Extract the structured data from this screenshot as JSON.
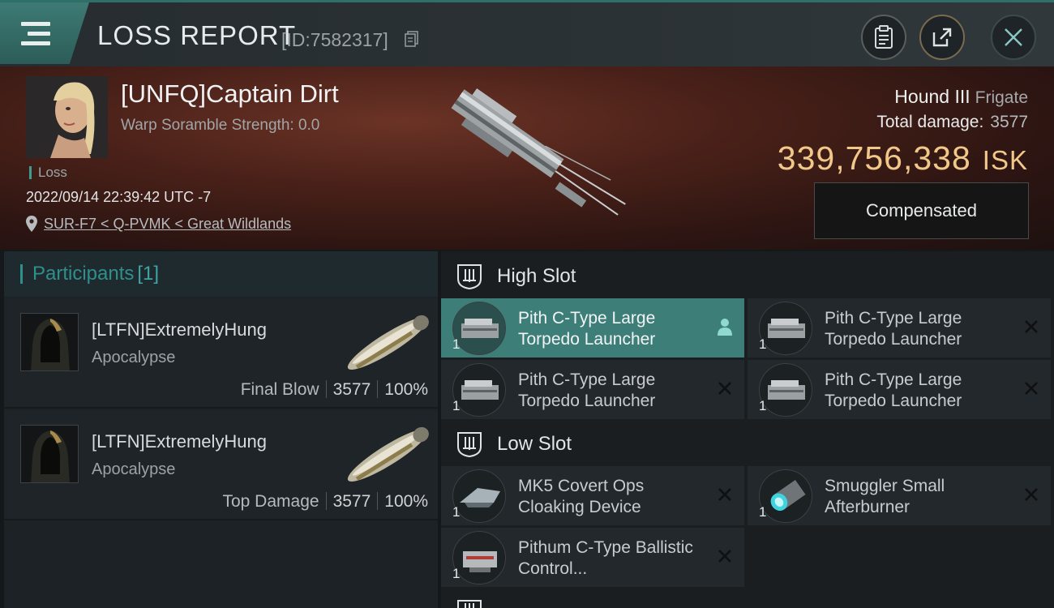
{
  "topbar": {
    "title": "LOSS REPORT",
    "report_id": "[ID:7582317]",
    "buttons": [
      "clipboard-icon",
      "share-icon",
      "close-icon"
    ]
  },
  "victim": {
    "name": "[UNFQ]Captain Dirt",
    "warp_scramble": "Warp Soramble Strength: 0.0",
    "status": "Loss",
    "datetime": "2022/09/14 22:39:42 UTC -7",
    "location": "SUR-F7 < Q-PVMK < Great Wildlands",
    "ship_name": "Hound III",
    "ship_type": "Frigate",
    "total_damage_label": "Total damage:",
    "total_damage": "3577",
    "isk_value": "339,756,338",
    "isk_unit": "ISK",
    "compensated_label": "Compensated"
  },
  "participants": {
    "title": "Participants",
    "count": "[1]",
    "rows": [
      {
        "name": "[LTFN]ExtremelyHung",
        "ship": "Apocalypse",
        "role": "Final Blow",
        "damage": "3577",
        "percent": "100%"
      },
      {
        "name": "[LTFN]ExtremelyHung",
        "ship": "Apocalypse",
        "role": "Top Damage",
        "damage": "3577",
        "percent": "100%"
      }
    ]
  },
  "fitting": {
    "high_slot_label": "High Slot",
    "low_slot_label": "Low Slot",
    "high": [
      {
        "name": "Pith C-Type Large Torpedo Launcher",
        "qty": "1"
      },
      {
        "name": "Pith C-Type Large Torpedo Launcher",
        "qty": "1"
      },
      {
        "name": "Pith C-Type Large Torpedo Launcher",
        "qty": "1"
      },
      {
        "name": "Pith C-Type Large Torpedo Launcher",
        "qty": "1"
      }
    ],
    "low": [
      {
        "name": "MK5 Covert Ops Cloaking Device",
        "qty": "1"
      },
      {
        "name": "Smuggler Small Afterburner",
        "qty": "1"
      },
      {
        "name": "Pithum C-Type Ballistic Control...",
        "qty": "1"
      }
    ]
  },
  "colors": {
    "accent": "#3e7e79",
    "isk": "#f1c88a",
    "loss_marker": "#3f9c90"
  }
}
